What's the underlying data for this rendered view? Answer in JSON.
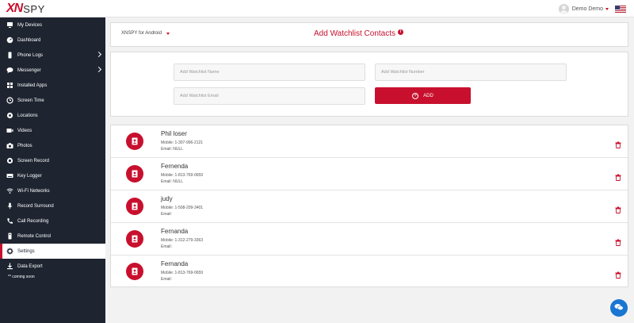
{
  "brand": {
    "logo_mark": "XN",
    "logo_text": "SPY"
  },
  "topbar": {
    "user_name": "Demo Demo",
    "flag_icon": "us-flag-icon"
  },
  "sidebar": {
    "items": [
      {
        "label": "My Devices",
        "icon": "device-icon"
      },
      {
        "label": "Dashboard",
        "icon": "dashboard-icon"
      },
      {
        "label": "Phone Logs",
        "icon": "phone-icon",
        "has_submenu": true
      },
      {
        "label": "Messenger",
        "icon": "messenger-icon",
        "has_submenu": true
      },
      {
        "label": "Installed Apps",
        "icon": "apps-icon"
      },
      {
        "label": "Screen Time",
        "icon": "clock-icon"
      },
      {
        "label": "Locations",
        "icon": "location-icon"
      },
      {
        "label": "Videos",
        "icon": "video-icon"
      },
      {
        "label": "Photos",
        "icon": "camera-icon"
      },
      {
        "label": "Screen Record",
        "icon": "record-icon"
      },
      {
        "label": "Key Logger",
        "icon": "keyboard-icon"
      },
      {
        "label": "Wi-Fi Networks",
        "icon": "wifi-icon"
      },
      {
        "label": "Record Surround",
        "icon": "microphone-icon"
      },
      {
        "label": "Call Recording",
        "icon": "phone-icon"
      },
      {
        "label": "Remote Control",
        "icon": "remote-icon"
      },
      {
        "label": "Settings",
        "icon": "gear-icon",
        "active": true
      },
      {
        "label": "Data Export",
        "icon": "download-icon"
      }
    ],
    "coming_soon": "** coming soon"
  },
  "header": {
    "platform": "XNSPY for Android",
    "title": "Add Watchlist Contacts",
    "info_badge": "i"
  },
  "form": {
    "name_placeholder": "Add Watchlist Name",
    "number_placeholder": "Add Watchlist Number",
    "email_placeholder": "Add Watchlist Email",
    "add_label": "ADD",
    "add_symbol": "+"
  },
  "contacts": [
    {
      "name": "Phil loser",
      "mobile": "Mobile: 1-307-996-2121",
      "email": "Email: NULL"
    },
    {
      "name": "Fernenda",
      "mobile": "Mobile: 1-813-769-0659",
      "email": "Email: NULL"
    },
    {
      "name": "judy",
      "mobile": "Mobile: 1-508-209-3401",
      "email": "Email:"
    },
    {
      "name": "Fernanda",
      "mobile": "Mobile: 1-312-279-3363",
      "email": "Email:"
    },
    {
      "name": "Fernanda",
      "mobile": "Mobile: 1-813-769-0659",
      "email": "Email:"
    }
  ],
  "colors": {
    "brand_red": "#c8102e",
    "sidebar_bg": "#1e2430",
    "chat_blue": "#1976d2"
  }
}
